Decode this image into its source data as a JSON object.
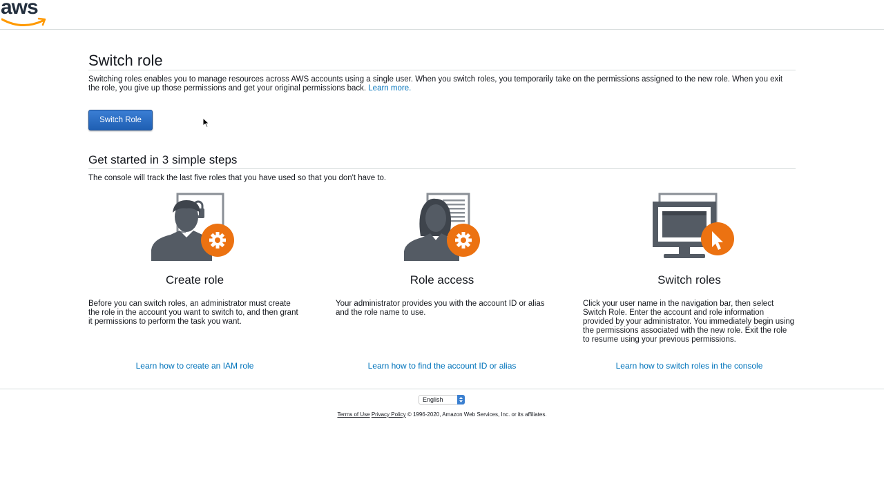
{
  "header": {
    "logo_text": "aws"
  },
  "page": {
    "title": "Switch role",
    "intro": "Switching roles enables you to manage resources across AWS accounts using a single user. When you switch roles, you temporarily take on the permissions assigned to the new role. When you exit the role, you give up those permissions and get your original permissions back.",
    "learn_more": "Learn more.",
    "switch_button": "Switch Role"
  },
  "steps": {
    "title": "Get started in 3 simple steps",
    "subtitle": "The console will track the last five roles that you have used so that you don't have to.",
    "items": [
      {
        "title": "Create role",
        "description": "Before you can switch roles, an administrator must create the role in the account you want to switch to, and then grant it permissions to perform the task you want.",
        "link": "Learn how to create an IAM role",
        "icon": "person-lock-gear-icon"
      },
      {
        "title": "Role access",
        "description": "Your administrator provides you with the account ID or alias and the role name to use.",
        "link": "Learn how to find the account ID or alias",
        "icon": "person-document-gear-icon"
      },
      {
        "title": "Switch roles",
        "description": "Click your user name in the navigation bar, then select Switch Role. Enter the account and role information provided by your administrator. You immediately begin using the permissions associated with the new role. Exit the role to resume using your previous permissions.",
        "link": "Learn how to switch roles in the console",
        "icon": "monitor-cursor-icon"
      }
    ]
  },
  "footer": {
    "language": "English",
    "terms": "Terms of Use",
    "privacy": "Privacy Policy",
    "copyright": "© 1996-2020, Amazon Web Services, Inc. or its affiliates."
  },
  "colors": {
    "accent_orange": "#ec7211",
    "link_blue": "#0073bb",
    "button_blue": "#2264bd",
    "icon_gray": "#545b64"
  }
}
